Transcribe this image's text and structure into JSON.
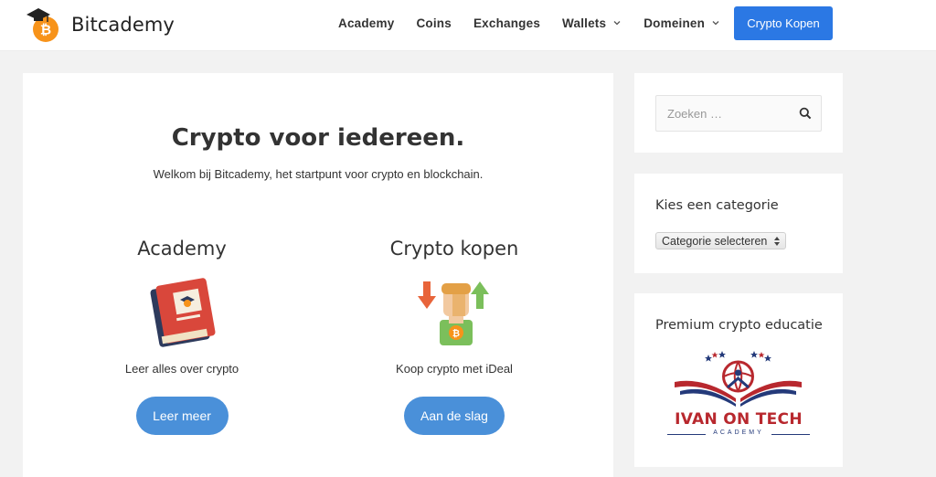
{
  "header": {
    "logo_text": "Bitcademy",
    "nav": [
      {
        "label": "Academy",
        "dropdown": false
      },
      {
        "label": "Coins",
        "dropdown": false
      },
      {
        "label": "Exchanges",
        "dropdown": false
      },
      {
        "label": "Wallets",
        "dropdown": true
      },
      {
        "label": "Domeinen",
        "dropdown": true
      }
    ],
    "cta_label": "Crypto Kopen"
  },
  "hero": {
    "title": "Crypto voor iedereen.",
    "subtitle": "Welkom bij Bitcademy, het startpunt voor crypto en blockchain."
  },
  "features": [
    {
      "title": "Academy",
      "icon": "book-icon",
      "description": "Leer alles over crypto",
      "button": "Leer meer"
    },
    {
      "title": "Crypto kopen",
      "icon": "trader-icon",
      "description": "Koop crypto met iDeal",
      "button": "Aan de slag"
    }
  ],
  "sidebar": {
    "search": {
      "placeholder": "Zoeken …"
    },
    "category": {
      "title": "Kies een categorie",
      "selected": "Categorie selecteren"
    },
    "promo": {
      "title": "Premium crypto educatie",
      "logo_text": "IVAN ON TECH",
      "logo_sub": "ACADEMY"
    }
  },
  "colors": {
    "accent": "#2b78e4",
    "button": "#4a90d9",
    "bitcoin": "#f7931a",
    "page_bg": "#f2f2f2",
    "promo_red": "#b8282e",
    "promo_blue": "#243a7a"
  }
}
